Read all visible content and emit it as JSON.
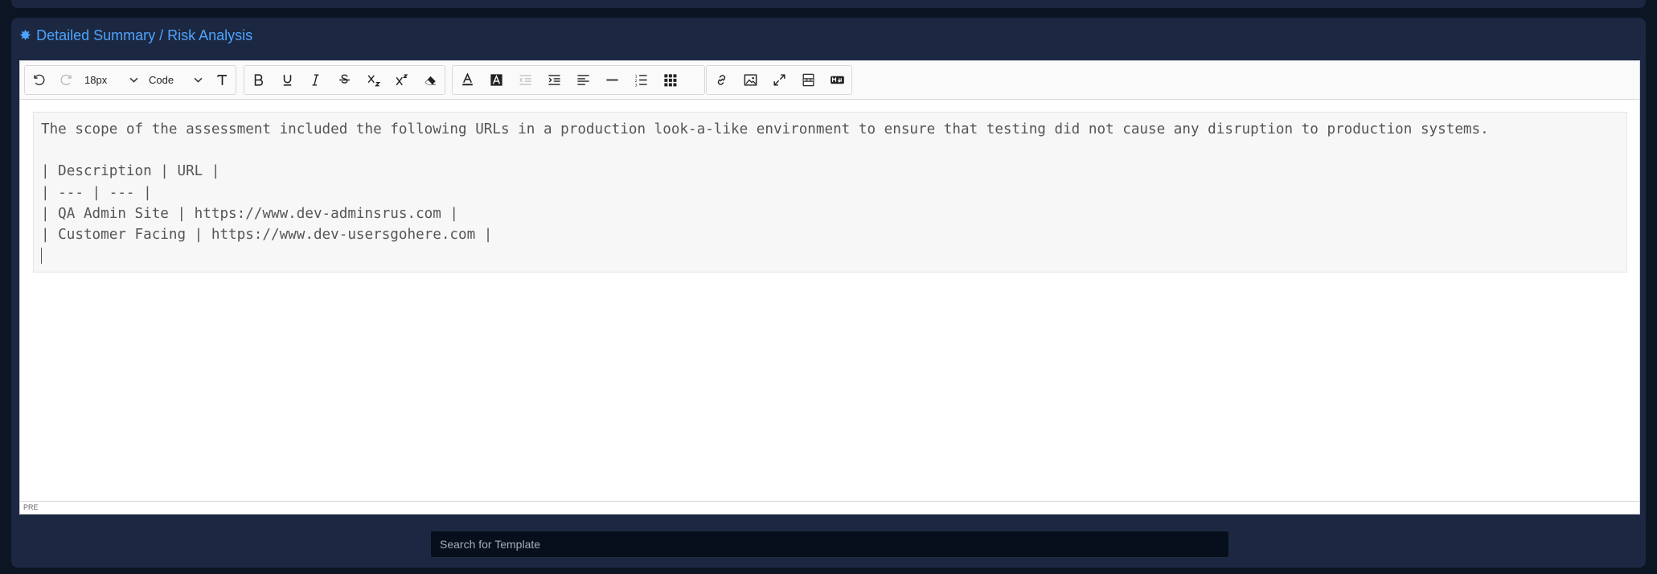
{
  "panel": {
    "title": "Detailed Summary / Risk Analysis",
    "title_icon": "asterisk-icon",
    "accent_color": "#4da3ff"
  },
  "toolbar": {
    "undo_icon": "undo-icon",
    "redo_icon": "redo-icon",
    "font_size": "18px",
    "block_format": "Code",
    "items": [
      "clear-format-icon",
      "bold-icon",
      "underline-icon",
      "italic-icon",
      "strikethrough-icon",
      "subscript-icon",
      "superscript-icon",
      "eraser-icon",
      "text-color-icon",
      "background-color-icon",
      "outdent-icon",
      "indent-icon",
      "align-left-icon",
      "horizontal-rule-icon",
      "numbered-list-icon",
      "table-icon",
      "link-icon",
      "image-icon",
      "fullscreen-icon",
      "page-break-icon",
      "markdown-icon"
    ]
  },
  "editor": {
    "lines": [
      "The scope of the assessment included the following URLs in a production look-a-like environment to ensure that testing did not cause any disruption to production systems.",
      "",
      "| Description | URL |",
      "| --- | --- |",
      "| QA Admin Site | https://www.dev-adminsrus.com |",
      "| Customer Facing | https://www.dev-usersgohere.com |"
    ],
    "status_path": "PRE"
  },
  "search": {
    "placeholder": "Search for Template",
    "value": ""
  }
}
